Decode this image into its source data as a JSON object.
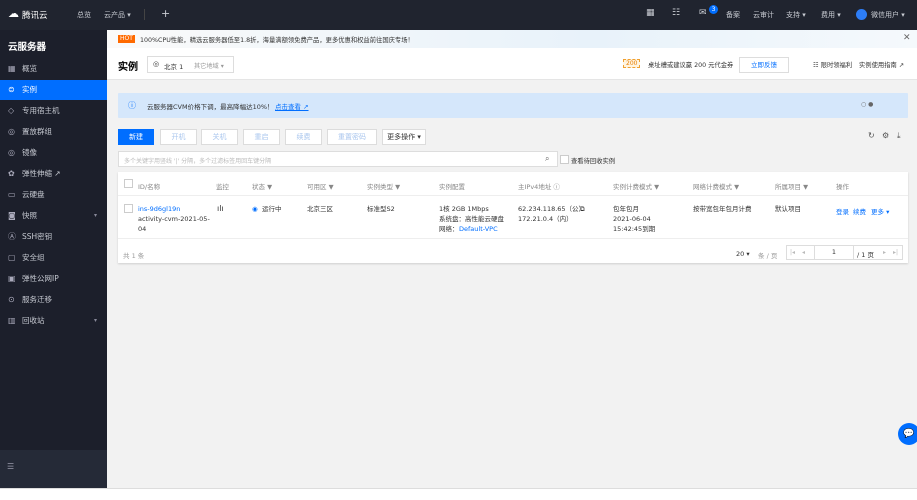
{
  "topbar": {
    "logo": "腾讯云",
    "overview": "总览",
    "products": "云产品 ▾",
    "plus": "+",
    "badge": "3",
    "beian": "备案",
    "audit": "云审计",
    "support": "支持 ▾",
    "billing": "费用 ▾",
    "user": "微信用户 ▾"
  },
  "sidebar": {
    "title": "云服务器",
    "items": [
      {
        "label": "概览",
        "icon": "grid-icon"
      },
      {
        "label": "实例",
        "icon": "instance-icon",
        "active": true
      },
      {
        "label": "专用宿主机",
        "icon": "host-icon"
      },
      {
        "label": "置放群组",
        "icon": "group-icon"
      },
      {
        "label": "镜像",
        "icon": "image-icon"
      },
      {
        "label": "弹性伸缩 ↗",
        "icon": "scale-icon"
      },
      {
        "label": "云硬盘",
        "icon": "disk-icon"
      },
      {
        "label": "快照",
        "icon": "camera-icon",
        "expand": true
      },
      {
        "label": "SSH密钥",
        "icon": "key-icon"
      },
      {
        "label": "安全组",
        "icon": "shield-icon"
      },
      {
        "label": "弹性公网IP",
        "icon": "ip-icon"
      },
      {
        "label": "服务迁移",
        "icon": "migrate-icon"
      },
      {
        "label": "回收站",
        "icon": "trash-icon",
        "expand": true
      }
    ]
  },
  "banner": {
    "tag": "HOT",
    "text": "100%CPU性能，精选云服务器低至1.8折，海量满额领免费产品，更多优惠和权益前往国庆专场！"
  },
  "header": {
    "title": "实例",
    "region": "北京 1",
    "other_region": "其它地域 ▾",
    "coupon": "200",
    "coupon_text": "桌址槽或建议赢 200 元代金券",
    "feedback": "立即反馈",
    "benefit": "限时领福利",
    "guide": "实例使用指南 ↗"
  },
  "notice": {
    "text": "云服务器CVM价格下调，最高降幅达10%！",
    "link": "点击查看 ↗"
  },
  "toolbar": {
    "new": "新建",
    "start": "开机",
    "stop": "关机",
    "restart": "重启",
    "renew": "续费",
    "reset_pwd": "重置密码",
    "more": "更多操作 ▾"
  },
  "search": {
    "placeholder": "多个关键字用竖线 '|' 分隔，多个过滤标签用回车键分隔",
    "recycle": "查看待回收实例"
  },
  "table": {
    "headers": [
      "ID/名称",
      "监控",
      "状态 ▼",
      "可用区 ▼",
      "实例类型 ▼",
      "实例配置",
      "主IPv4地址 ⓘ",
      "实例计费模式 ▼",
      "网络计费模式 ▼",
      "所属项目 ▼",
      "操作"
    ],
    "row": {
      "id": "ins-9d6gl19n",
      "name": "activity-cvm-2021-05-04",
      "status": "运行中",
      "zone": "北京三区",
      "type": "标准型S2",
      "config1": "1核 2GB 1Mbps",
      "config2": "系统盘：高性能云硬盘",
      "config3_label": "网络：",
      "config3_link": "Default-VPC",
      "ip_public": "62.234.118.65（公）",
      "ip_private": "172.21.0.4（内）",
      "billing": "包年包月",
      "expire_date": "2021-06-04",
      "expire_time": "15:42:45到期",
      "net_billing": "按带宽包年包月计费",
      "project": "默认项目",
      "act_login": "登录",
      "act_renew": "续费",
      "act_more": "更多 ▾"
    },
    "total": "共 1 条",
    "page_size": "20 ▾",
    "per_page": "条 / 页",
    "page": "1",
    "pages": "/ 1 页"
  }
}
